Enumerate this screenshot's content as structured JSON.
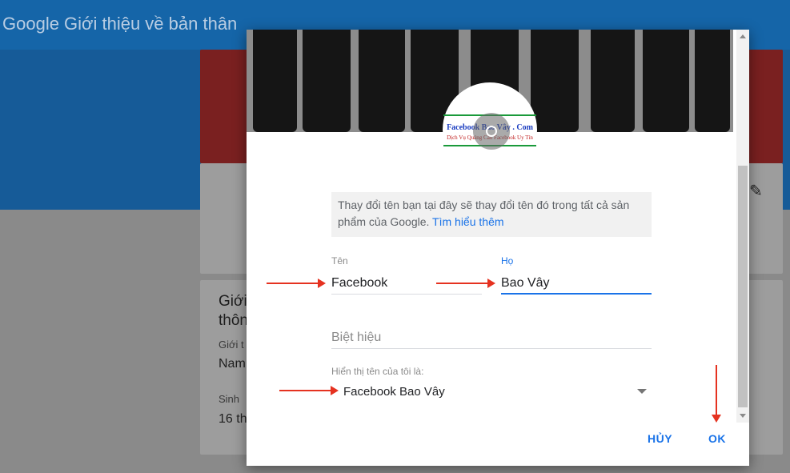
{
  "app": {
    "title": "Google Giới thiệu về bản thân"
  },
  "background": {
    "card_heading_1": "Giới",
    "card_heading_2": "thôn",
    "row1_label": "Giới t",
    "row1_value": "Nam",
    "row2_label": "Sinh",
    "row2_value": "16 th"
  },
  "dialog": {
    "logo": {
      "name": "Facebook Bao Vây . Com",
      "tagline": "Dịch Vụ Quảng Cáo Facebook Uy Tín"
    },
    "info": {
      "text": "Thay đổi tên bạn tại đây sẽ thay đổi tên đó trong tất cả sản phẩm của Google.",
      "link": "Tìm hiểu thêm"
    },
    "first_name": {
      "label": "Tên",
      "value": "Facebook"
    },
    "last_name": {
      "label": "Họ",
      "value": "Bao Vây"
    },
    "nickname": {
      "placeholder": "Biệt hiệu"
    },
    "display_as": {
      "label": "Hiển thị tên của tôi là:",
      "value": "Facebook Bao Vây"
    },
    "buttons": {
      "cancel": "HỦY",
      "ok": "OK"
    }
  },
  "colors": {
    "accent": "#1a73e8",
    "annotation": "#e53220",
    "app_bar": "#1565a8"
  },
  "icons": [
    "pencil-icon",
    "camera-icon",
    "chevron-down-icon",
    "scroll-up-icon",
    "scroll-down-icon"
  ]
}
